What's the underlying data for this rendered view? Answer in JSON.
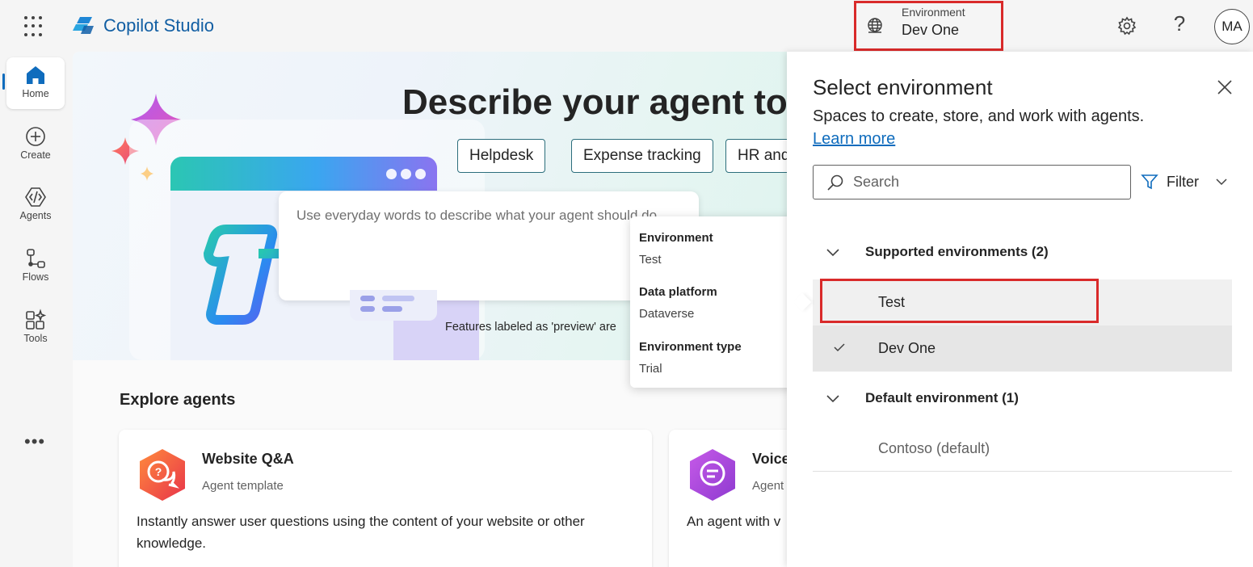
{
  "app": {
    "title": "Copilot Studio"
  },
  "environment_switcher": {
    "label": "Environment",
    "value": "Dev One"
  },
  "topbar": {
    "settings_icon": "gear-icon",
    "help_label": "?",
    "avatar_initials": "MA"
  },
  "leftnav": {
    "items": [
      {
        "label": "Home",
        "icon": "home-icon",
        "active": true
      },
      {
        "label": "Create",
        "icon": "plus-circle-icon"
      },
      {
        "label": "Agents",
        "icon": "agents-icon"
      },
      {
        "label": "Flows",
        "icon": "flows-icon"
      },
      {
        "label": "Tools",
        "icon": "tools-icon"
      }
    ],
    "more_label": "•••"
  },
  "hero": {
    "title": "Describe your agent to c",
    "chips": [
      "Helpdesk",
      "Expense tracking",
      "HR and"
    ],
    "prompt_placeholder": "Use everyday words to describe what your agent should do",
    "preview_note": "Features labeled as 'preview' are"
  },
  "explore": {
    "title": "Explore agents",
    "cards": [
      {
        "title": "Website Q&A",
        "subtitle": "Agent template",
        "description": "Instantly answer user questions using the content of your website or other knowledge.",
        "icon_color": "#f2572f"
      },
      {
        "title": "Voice",
        "subtitle": "Agent",
        "description": "An agent with v",
        "icon_color": "#b347d6"
      }
    ]
  },
  "tooltip": {
    "environment_heading": "Environment",
    "environment_value": "Test",
    "platform_heading": "Data platform",
    "platform_value": "Dataverse",
    "type_heading": "Environment type",
    "type_value": "Trial"
  },
  "panel": {
    "title": "Select environment",
    "description": "Spaces to create, store, and work with agents.",
    "learn_more": "Learn more",
    "search_placeholder": "Search",
    "filter_label": "Filter",
    "groups": [
      {
        "label": "Supported environments (2)",
        "items": [
          {
            "label": "Test",
            "selected": false,
            "highlighted": true
          },
          {
            "label": "Dev One",
            "selected": true
          }
        ]
      },
      {
        "label": "Default environment (1)",
        "items": [
          {
            "label": "Contoso (default)"
          }
        ]
      }
    ]
  },
  "colors": {
    "brand": "#115ea3",
    "highlight_border": "#d92a2a",
    "link": "#0f6cbd"
  }
}
